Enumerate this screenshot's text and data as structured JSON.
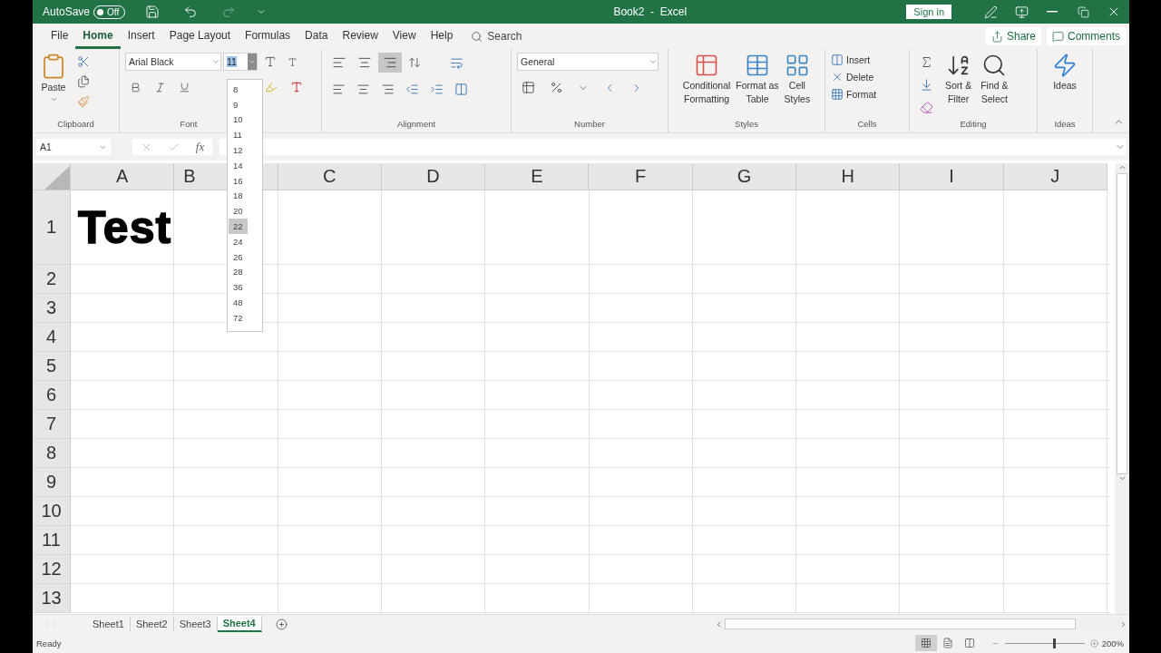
{
  "title_bar": {
    "autosave_label": "AutoSave",
    "autosave_toggle": {
      "label": "Off",
      "on": false
    },
    "title": "Book2  -  Excel",
    "sign_in": "Sign in"
  },
  "menu_tabs": [
    {
      "label": "File",
      "selected": false
    },
    {
      "label": "Home",
      "selected": true
    },
    {
      "label": "Insert",
      "selected": false
    },
    {
      "label": "Page Layout",
      "selected": false
    },
    {
      "label": "Formulas",
      "selected": false
    },
    {
      "label": "Data",
      "selected": false
    },
    {
      "label": "Review",
      "selected": false
    },
    {
      "label": "View",
      "selected": false
    },
    {
      "label": "Help",
      "selected": false
    }
  ],
  "search": {
    "placeholder": "Search"
  },
  "share": "Share",
  "comments": "Comments",
  "ribbon": {
    "clipboard": {
      "label": "Clipboard",
      "paste": "Paste"
    },
    "font": {
      "label": "Font",
      "font_name": "Arial Black",
      "font_size": "11",
      "font_size_text_selected": true
    },
    "alignment": {
      "label": "Alignment",
      "vertical": [
        {
          "kind": "top",
          "selected": false
        },
        {
          "kind": "middle",
          "selected": false
        },
        {
          "kind": "bottom",
          "selected": true
        }
      ]
    },
    "number": {
      "label": "Number",
      "format": "General"
    },
    "styles": {
      "label": "Styles",
      "buttons": [
        {
          "kind": "conditional",
          "lines": [
            "Conditional",
            "Formatting"
          ]
        },
        {
          "kind": "table",
          "lines": [
            "Format as",
            "Table"
          ]
        },
        {
          "kind": "cell",
          "lines": [
            "Cell",
            "Styles"
          ]
        }
      ]
    },
    "cells": {
      "label": "Cells",
      "buttons": [
        {
          "kind": "insert",
          "label": "Insert"
        },
        {
          "kind": "delete",
          "label": "Delete"
        },
        {
          "kind": "format",
          "label": "Format"
        }
      ]
    },
    "editing": {
      "label": "Editing",
      "buttons": [
        {
          "kind": "sort",
          "lines": [
            "Sort &",
            "Filter"
          ]
        },
        {
          "kind": "find",
          "lines": [
            "Find &",
            "Select"
          ]
        }
      ]
    },
    "ideas": {
      "label": "Ideas",
      "button": "Ideas"
    }
  },
  "font_size_dropdown": [
    {
      "label": "8",
      "selected": false
    },
    {
      "label": "9",
      "selected": false
    },
    {
      "label": "10",
      "selected": false
    },
    {
      "label": "11",
      "selected": false
    },
    {
      "label": "12",
      "selected": false
    },
    {
      "label": "14",
      "selected": false
    },
    {
      "label": "16",
      "selected": false
    },
    {
      "label": "18",
      "selected": false
    },
    {
      "label": "20",
      "selected": false
    },
    {
      "label": "22",
      "selected": true
    },
    {
      "label": "24",
      "selected": false
    },
    {
      "label": "26",
      "selected": false
    },
    {
      "label": "28",
      "selected": false
    },
    {
      "label": "36",
      "selected": false
    },
    {
      "label": "48",
      "selected": false
    },
    {
      "label": "72",
      "selected": false
    }
  ],
  "formula_bar": {
    "name_box": "A1",
    "function_label": "fx"
  },
  "sheet": {
    "columns": [
      "A",
      "B",
      "C",
      "D",
      "E",
      "F",
      "G",
      "H",
      "I",
      "J"
    ],
    "rows": [
      {
        "label": "1",
        "values": [
          "Test"
        ]
      },
      {
        "label": "2"
      },
      {
        "label": "3"
      },
      {
        "label": "4"
      },
      {
        "label": "5"
      },
      {
        "label": "6"
      },
      {
        "label": "7"
      },
      {
        "label": "8"
      },
      {
        "label": "9"
      },
      {
        "label": "10"
      },
      {
        "label": "11"
      },
      {
        "label": "12"
      },
      {
        "label": "13"
      }
    ]
  },
  "sheet_tabs": [
    {
      "label": "Sheet1",
      "selected": false
    },
    {
      "label": "Sheet2",
      "selected": false
    },
    {
      "label": "Sheet3",
      "selected": false
    },
    {
      "label": "Sheet4",
      "selected": true
    }
  ],
  "status_bar": {
    "status": "Ready",
    "views": [
      {
        "kind": "normal",
        "selected": true
      },
      {
        "kind": "page_layout",
        "selected": false
      },
      {
        "kind": "page_break",
        "selected": false
      }
    ],
    "zoom": {
      "level": 0.62,
      "reading": "200%"
    }
  }
}
